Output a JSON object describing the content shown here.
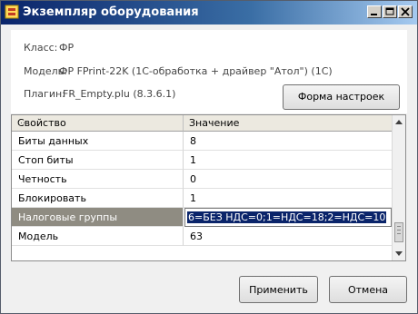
{
  "window": {
    "title": "Экземпляр оборудования"
  },
  "info": {
    "class_label": "Класс:",
    "class_value": "ФР",
    "model_label": "Модель:",
    "model_value": "ФР FPrint-22K (1С-обработка + драйвер \"Атол\") (1С)",
    "plugin_label": "Плагин:",
    "plugin_value": "FR_Empty.plu (8.3.6.1)",
    "settings_button": "Форма настроек"
  },
  "grid": {
    "col_property": "Свойство",
    "col_value": "Значение",
    "rows": [
      {
        "property": "Биты данных",
        "value": "8"
      },
      {
        "property": "Стоп биты",
        "value": "1"
      },
      {
        "property": "Четность",
        "value": "0"
      },
      {
        "property": "Блокировать",
        "value": "1"
      },
      {
        "property": "Налоговые группы",
        "value": "6=БЕЗ НДС=0;1=НДС=18;2=НДС=10"
      },
      {
        "property": "Модель",
        "value": "63"
      }
    ],
    "selected_row": 4
  },
  "buttons": {
    "apply": "Применить",
    "cancel": "Отмена"
  },
  "colors": {
    "title_gradient_start": "#0a246a",
    "selection": "#0a246a",
    "selected_row_bg": "#8f8c82"
  }
}
